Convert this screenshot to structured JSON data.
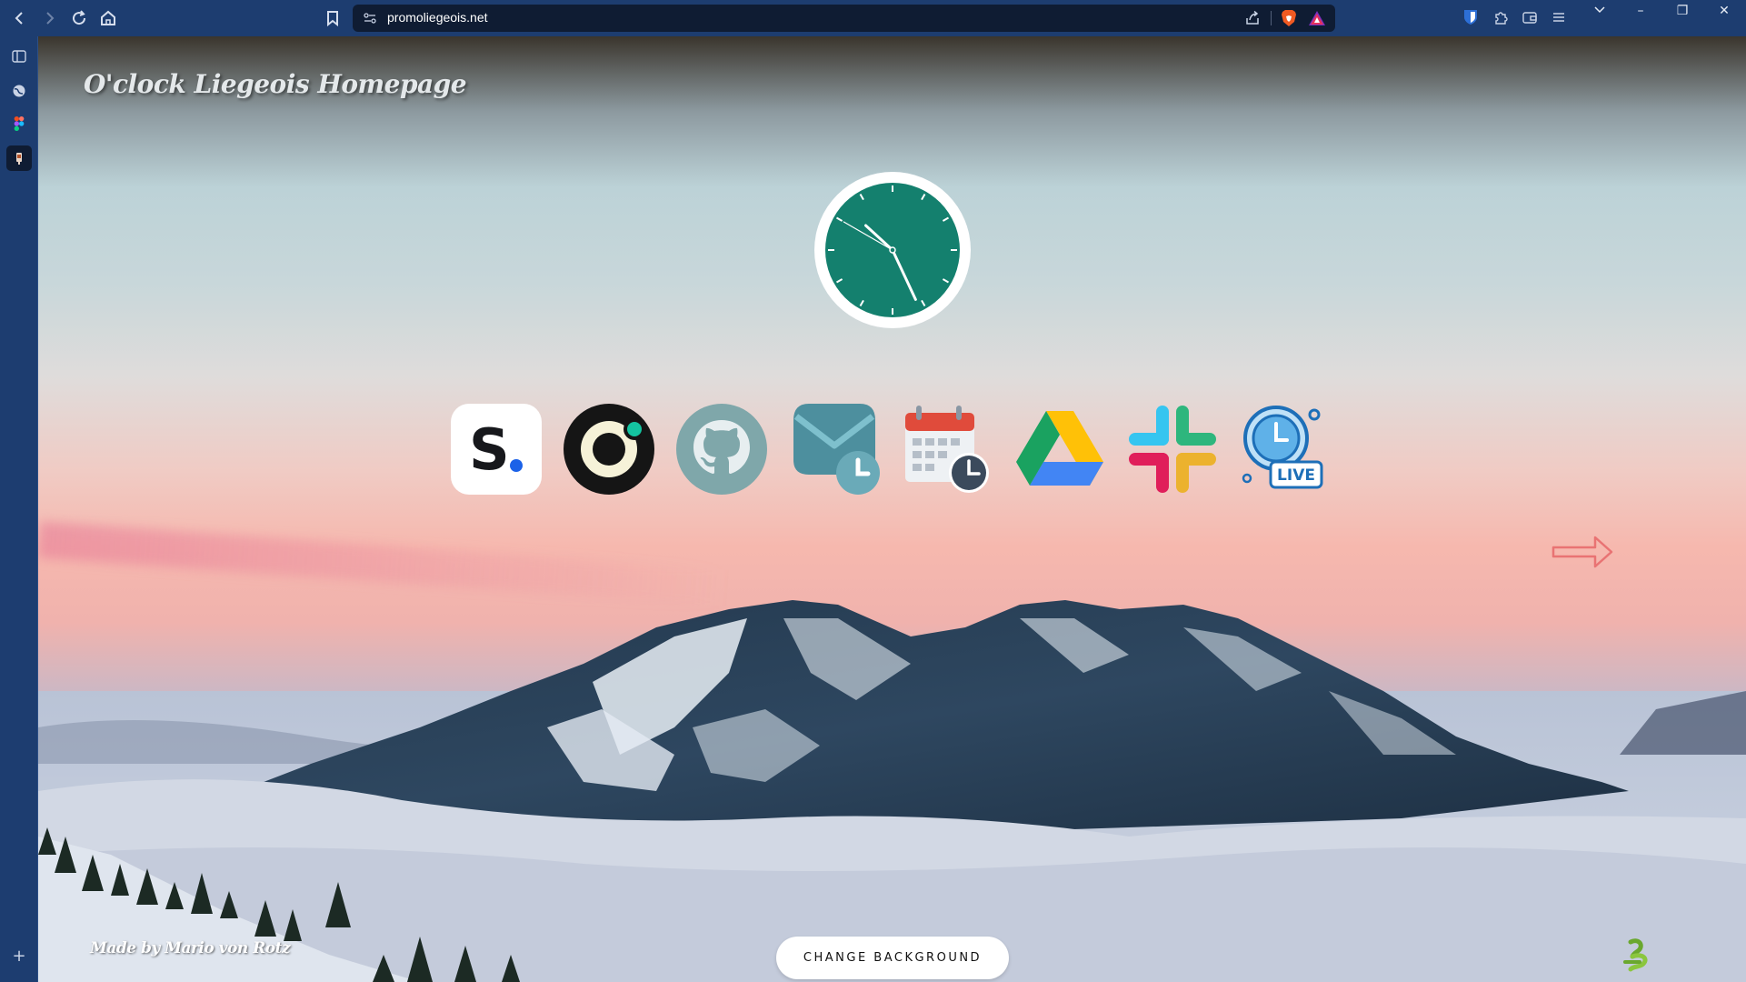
{
  "browser": {
    "url": "promoliegeois.net",
    "nav": {
      "back_icon": "chevron-left-icon",
      "forward_icon": "chevron-right-icon",
      "reload_icon": "reload-icon",
      "home_icon": "home-icon",
      "bookmark_icon": "bookmark-icon"
    },
    "window_controls": {
      "tabs_icon": "chevron-down-icon",
      "minimize": "–",
      "restore": "❐",
      "close": "✕"
    }
  },
  "sidebar": {
    "items": [
      "sidebar-panel-icon",
      "globe-icon",
      "figma-icon",
      "app-tile-icon"
    ],
    "add_label": "+"
  },
  "page": {
    "title": "O'clock Liegeois Homepage",
    "credit": "Made by Mario von Rotz",
    "change_background_label": "CHANGE BACKGROUND",
    "apps": [
      {
        "name": "s-app",
        "label": "S."
      },
      {
        "name": "ring-app",
        "label": ""
      },
      {
        "name": "github",
        "label": ""
      },
      {
        "name": "scheduled-mail",
        "label": ""
      },
      {
        "name": "calendar-clock",
        "label": ""
      },
      {
        "name": "google-drive",
        "label": ""
      },
      {
        "name": "slack",
        "label": ""
      },
      {
        "name": "live-clock",
        "label": "LIVE"
      }
    ],
    "clock": {
      "hour": 10,
      "minute": 25,
      "second": 50
    }
  },
  "colors": {
    "clock_face": "#14806e",
    "browser_chrome": "#1d3d70",
    "urlbar": "#0f1c33"
  }
}
